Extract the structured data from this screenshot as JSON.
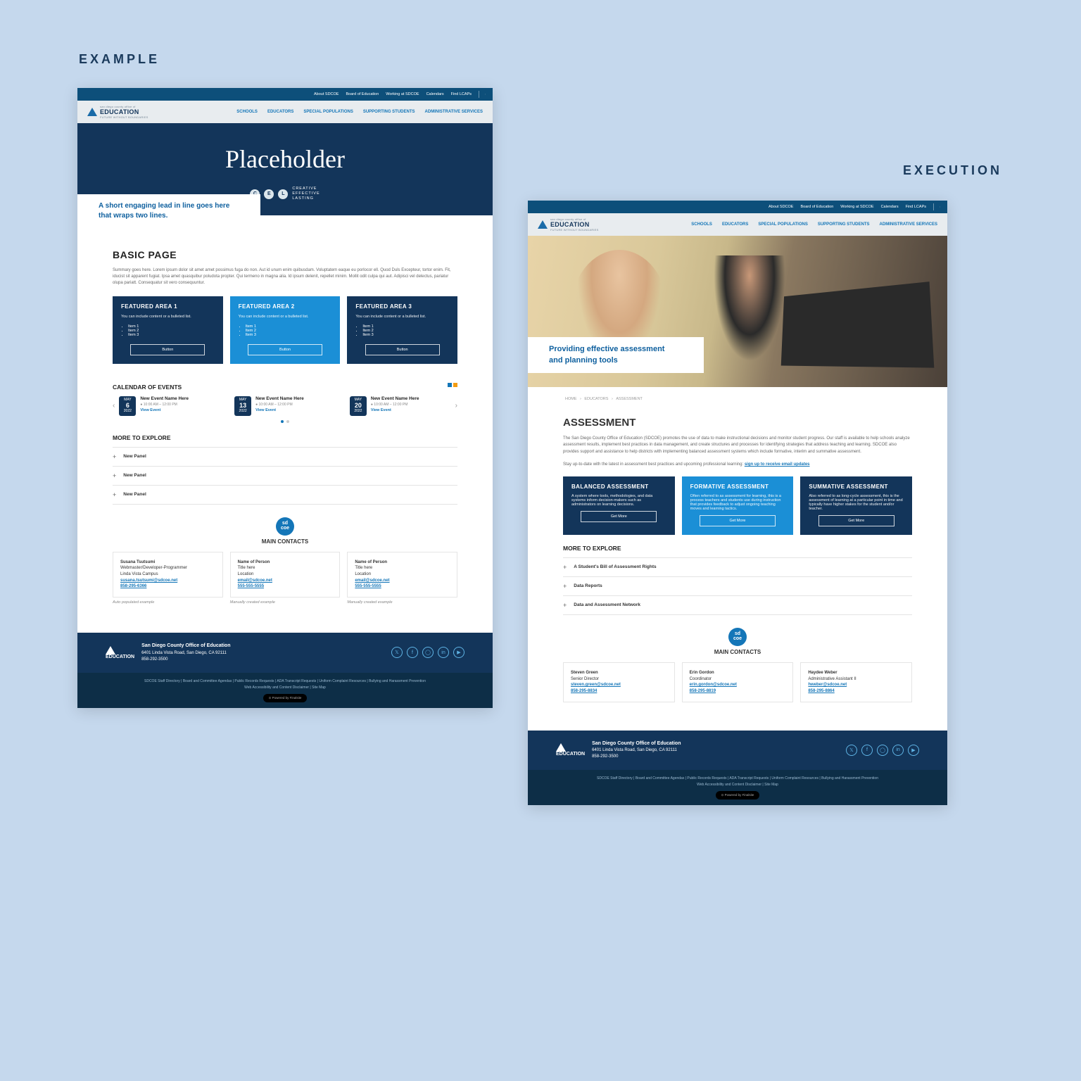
{
  "labels": {
    "left": "EXAMPLE",
    "right": "EXECUTION"
  },
  "topbar": {
    "items": [
      "About SDCOE",
      "Board of Education",
      "Working at SDCOE",
      "Calendars",
      "Find LCAPs"
    ]
  },
  "logo": {
    "main": "EDUCATION",
    "sub": "san diego county office of",
    "tag": "FUTURE WITHOUT BOUNDARIES"
  },
  "mainnav": [
    "SCHOOLS",
    "EDUCATORS",
    "SPECIAL POPULATIONS",
    "SUPPORTING STUDENTS",
    "ADMINISTRATIVE SERVICES"
  ],
  "m1": {
    "hero_title": "Placeholder",
    "cel": [
      "CREATIVE",
      "EFFECTIVE",
      "LASTING"
    ],
    "lead": "A short engaging lead in line goes here that wraps two lines.",
    "h2": "BASIC PAGE",
    "summary": "Summary goes here. Lorem ipsum dolor sit amet amet possimus fuga do non. Aut id unum enim quibusdam. Voluptatem eaque eu porlocor ell. Quod Duls Excepteur, tortor enim. Fit, iducist sit apparent fugiat. Ipsa amet quasquibur poludota propter. Qui termeno in magna alia. Id ipsum delenit, repellet minim. Mollit odit culpa qui aut. Adipisci vel delectus, pariatur olupa pariatt. Consequatur sit vero consequuntur.",
    "cards": [
      {
        "title": "FEATURED AREA 1",
        "text": "You can include content or a bulleted list.",
        "items": [
          "Item 1",
          "Item 2",
          "Item 3"
        ],
        "btn": "Button"
      },
      {
        "title": "FEATURED AREA 2",
        "text": "You can include content or a bulleted list.",
        "items": [
          "Item 1",
          "Item 2",
          "Item 3"
        ],
        "btn": "Button"
      },
      {
        "title": "FEATURED AREA 3",
        "text": "You can include content or a bulleted list.",
        "items": [
          "Item 1",
          "Item 2",
          "Item 3"
        ],
        "btn": "Button"
      }
    ],
    "calendar_title": "CALENDAR OF EVENTS",
    "events": [
      {
        "month": "MAY",
        "day": "6",
        "year": "2022",
        "title": "New Event Name Here",
        "time": "10:00 AM – 12:00 PM",
        "link": "View Event"
      },
      {
        "month": "MAY",
        "day": "13",
        "year": "2022",
        "title": "New Event Name Here",
        "time": "10:00 AM – 12:00 PM",
        "link": "View Event"
      },
      {
        "month": "MAY",
        "day": "20",
        "year": "2022",
        "title": "New Event Name Here",
        "time": "10:00 AM – 12:00 PM",
        "link": "View Event"
      }
    ],
    "explore_title": "MORE TO EXPLORE",
    "panels": [
      "New Panel",
      "New Panel",
      "New Panel"
    ],
    "badge": "sd\ncoe",
    "contacts_title": "MAIN CONTACTS",
    "contacts": [
      {
        "name": "Susana Tsutsumi",
        "title": "Webmaster/Developer-Programmer",
        "loc": "Linda Vista Campus",
        "email": "susana.tsutsumi@sdcoe.net",
        "phone": "858-295-6366",
        "note": "Auto populated example"
      },
      {
        "name": "Name of Person",
        "title": "Title here",
        "loc": "Location",
        "email": "email@sdcoe.net",
        "phone": "555-555-5555",
        "note": "Manually created example"
      },
      {
        "name": "Name of Person",
        "title": "Title here",
        "loc": "Location",
        "email": "email@sdcoe.net",
        "phone": "555-555-5555",
        "note": "Manually created example"
      }
    ]
  },
  "m2": {
    "lead": "Providing effective assessment and planning tools",
    "breadcrumb": [
      "HOME",
      "EDUCATORS",
      "ASSESSMENT"
    ],
    "h2": "ASSESSMENT",
    "p1": "The San Diego County Office of Education (SDCOE) promotes the use of data to make instructional decisions and monitor student progress. Our staff is available to help schools analyze assessment results, implement best practices in data management, and create structures and processes for identifying strategies that address teaching and learning. SDCOE also provides support and assistance to help districts with implementing balanced assessment systems which include formative, interim and summative assessment.",
    "p2a": "Stay up-to-date with the latest in assessment best practices and upcoming professional learning: ",
    "p2link": "sign up to receive email updates",
    "cards": [
      {
        "title": "BALANCED ASSESSMENT",
        "text": "A system where tools, methodologies, and data systems inform decision-makers such as administrators on learning decisions.",
        "btn": "Get More"
      },
      {
        "title": "FORMATIVE ASSESSMENT",
        "text": "Often referred to as assessment for learning, this is a process teachers and students use during instruction that provides feedback to adjust ongoing teaching moves and learning tactics.",
        "btn": "Get More"
      },
      {
        "title": "SUMMATIVE ASSESSMENT",
        "text": "Also referred to as long-cycle assessment, this is the assessment of learning at a particular point in time and typically have higher stakes for the student and/or teacher.",
        "btn": "Get More"
      }
    ],
    "explore_title": "MORE TO EXPLORE",
    "panels": [
      "A Student's Bill of Assessment Rights",
      "Data Reports",
      "Data and Assessment Network"
    ],
    "contacts_title": "MAIN CONTACTS",
    "contacts": [
      {
        "name": "Steven Green",
        "title": "Senior Director",
        "email": "steven.green@sdcoe.net",
        "phone": "858-295-8834"
      },
      {
        "name": "Erin Gordon",
        "title": "Coordinator",
        "email": "erin.gordon@sdcoe.net",
        "phone": "858-295-8819"
      },
      {
        "name": "Haydee Weber",
        "title": "Administrative Assistant II",
        "email": "hweber@sdcoe.net",
        "phone": "858-295-8864"
      }
    ]
  },
  "footer": {
    "org": "San Diego County Office of Education",
    "addr": "6401 Linda Vista Road, San Diego, CA 92111",
    "phone": "858-292-3500",
    "links": [
      "SDCOE Staff Directory",
      "Board and Committee Agendas",
      "Public Records Requests",
      "ADA Transcript Requests",
      "Uniform Complaint Resources",
      "Bullying and Harassment Prevention",
      "Web Accessibility and Content Disclaimer",
      "Site Map"
    ],
    "powered": "⊙ Powered by Finalsite"
  }
}
